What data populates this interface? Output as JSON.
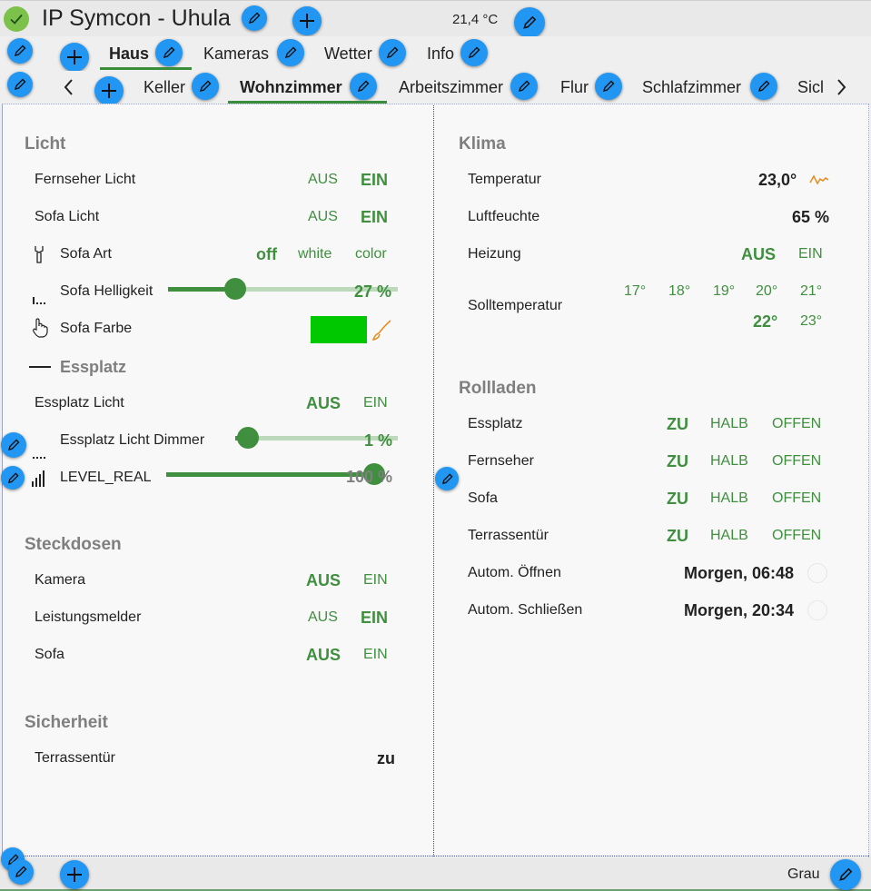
{
  "header": {
    "title": "IP Symcon - Uhula",
    "temperature": "21,4 °C",
    "status_icon": "check-circle-icon"
  },
  "tabs_main": [
    {
      "label": "Haus",
      "active": true
    },
    {
      "label": "Kameras",
      "active": false
    },
    {
      "label": "Wetter",
      "active": false
    },
    {
      "label": "Info",
      "active": false
    }
  ],
  "tabs_rooms": [
    {
      "label": "Keller",
      "active": false
    },
    {
      "label": "Wohnzimmer",
      "active": true
    },
    {
      "label": "Arbeitszimmer",
      "active": false
    },
    {
      "label": "Flur",
      "active": false
    },
    {
      "label": "Schlafzimmer",
      "active": false
    },
    {
      "label": "Sicl",
      "active": false
    }
  ],
  "licht": {
    "title": "Licht",
    "fernseher": {
      "label": "Fernseher Licht",
      "off": "AUS",
      "on": "EIN",
      "selected": "EIN"
    },
    "sofa": {
      "label": "Sofa Licht",
      "off": "AUS",
      "on": "EIN",
      "selected": "EIN"
    },
    "sofa_art": {
      "label": "Sofa Art",
      "options": [
        "off",
        "white",
        "color"
      ],
      "selected": "off"
    },
    "sofa_helligkeit": {
      "label": "Sofa Helligkeit",
      "value": "27 %",
      "level": 0.27
    },
    "sofa_farbe": {
      "label": "Sofa Farbe",
      "color": "#00c800"
    },
    "essplatz_header": "Essplatz",
    "essplatz_licht": {
      "label": "Essplatz Licht",
      "off": "AUS",
      "on": "EIN",
      "selected": "AUS"
    },
    "essplatz_dimmer": {
      "label": "Essplatz Licht Dimmer",
      "value": "1 %",
      "level": 0.01
    },
    "level_real": {
      "label": "LEVEL_REAL",
      "value": "100 %",
      "level": 1.0
    }
  },
  "steckdosen": {
    "title": "Steckdosen",
    "rows": [
      {
        "label": "Kamera",
        "off": "AUS",
        "on": "EIN",
        "selected": "AUS"
      },
      {
        "label": "Leistungsmelder",
        "off": "AUS",
        "on": "EIN",
        "selected": "EIN"
      },
      {
        "label": "Sofa",
        "off": "AUS",
        "on": "EIN",
        "selected": "AUS"
      }
    ]
  },
  "sicherheit": {
    "title": "Sicherheit",
    "terrassentuer": {
      "label": "Terrassentür",
      "value": "zu"
    }
  },
  "klima": {
    "title": "Klima",
    "temperatur": {
      "label": "Temperatur",
      "value": "23,0°"
    },
    "luftfeuchte": {
      "label": "Luftfeuchte",
      "value": "65 %"
    },
    "heizung": {
      "label": "Heizung",
      "off": "AUS",
      "on": "EIN",
      "selected": "AUS"
    },
    "solltemperatur": {
      "label": "Solltemperatur",
      "options": [
        "17°",
        "18°",
        "19°",
        "20°",
        "21°",
        "22°",
        "23°"
      ],
      "selected": "22°"
    }
  },
  "rollladen": {
    "title": "Rollladen",
    "rows": [
      {
        "label": "Essplatz",
        "options": [
          "ZU",
          "HALB",
          "OFFEN"
        ],
        "selected": "ZU"
      },
      {
        "label": "Fernseher",
        "options": [
          "ZU",
          "HALB",
          "OFFEN"
        ],
        "selected": "ZU"
      },
      {
        "label": "Sofa",
        "options": [
          "ZU",
          "HALB",
          "OFFEN"
        ],
        "selected": "ZU"
      },
      {
        "label": "Terrassentür",
        "options": [
          "ZU",
          "HALB",
          "OFFEN"
        ],
        "selected": "ZU"
      }
    ],
    "autom_oeffnen": {
      "label": "Autom. Öffnen",
      "value": "Morgen, 06:48"
    },
    "autom_schliessen": {
      "label": "Autom. Schließen",
      "value": "Morgen, 20:34"
    }
  },
  "footer": {
    "theme": "Grau"
  },
  "colors": {
    "accent_green": "#3f8f3f",
    "edit_blue": "#2196f3",
    "status_green": "#7cc24a"
  }
}
